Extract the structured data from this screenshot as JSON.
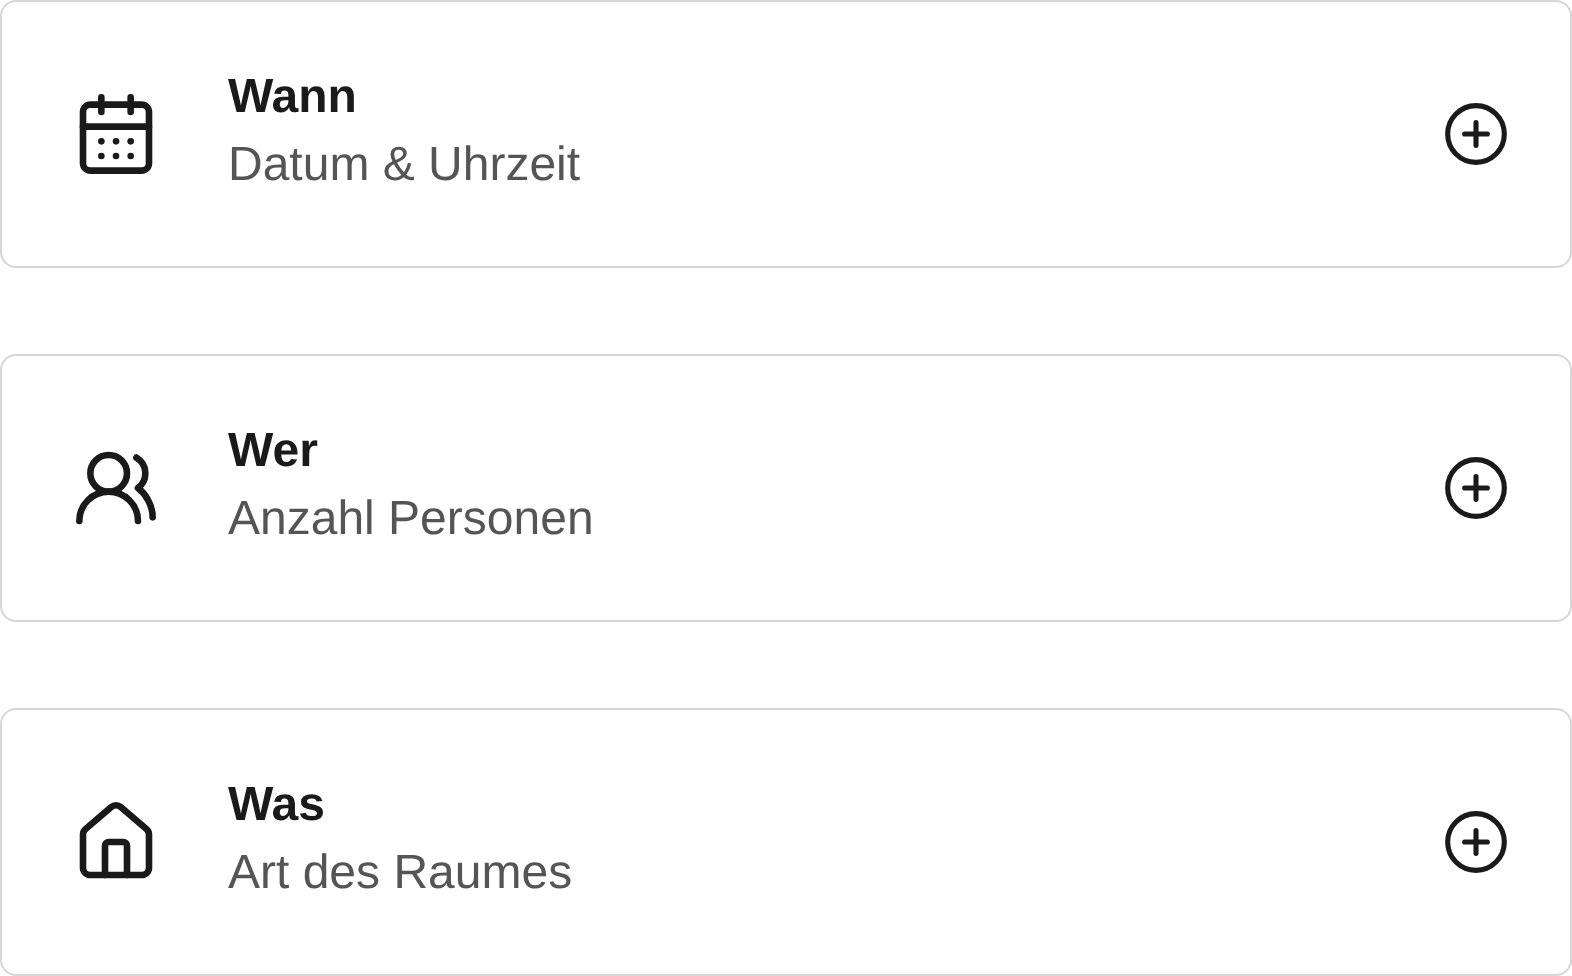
{
  "cards": [
    {
      "kind": "calendar",
      "title": "Wann",
      "subtitle": "Datum & Uhrzeit"
    },
    {
      "kind": "people",
      "title": "Wer",
      "subtitle": "Anzahl Personen"
    },
    {
      "kind": "home",
      "title": "Was",
      "subtitle": "Art des Raumes"
    }
  ]
}
